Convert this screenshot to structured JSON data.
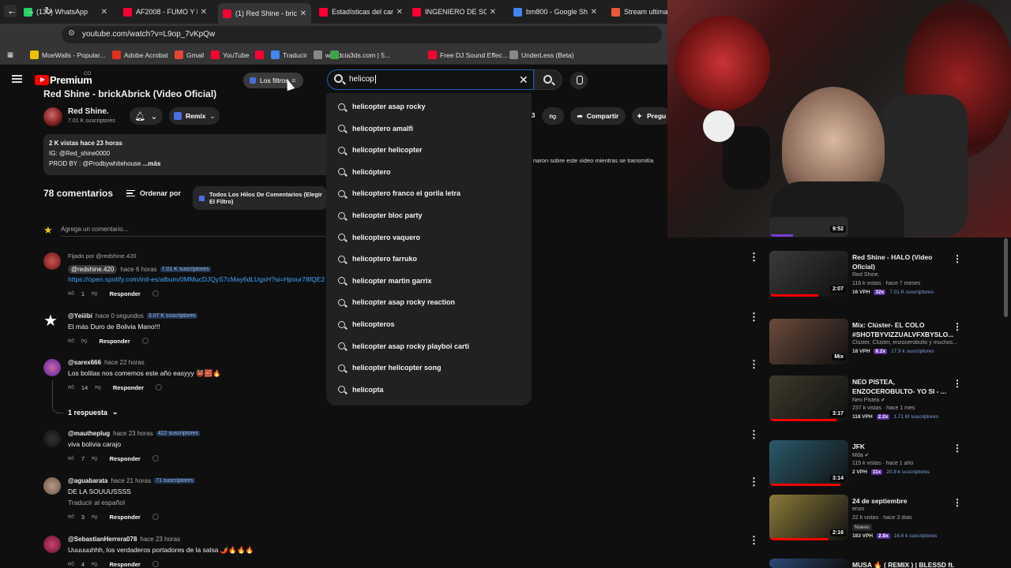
{
  "tabs": [
    {
      "label": "(130) WhatsApp",
      "color": "#25d366"
    },
    {
      "label": "AF2008 - FUMO Y DE",
      "color": "#ff0033"
    },
    {
      "label": "(1) Red Shine - brickA",
      "color": "#ff0033"
    },
    {
      "label": "Estadísticas del canal",
      "color": "#ff0033"
    },
    {
      "label": "INGENIERO DE SONI",
      "color": "#ff0033"
    },
    {
      "label": "bm800 - Google Sho",
      "color": "#4285f4"
    },
    {
      "label": "Stream ultimat",
      "color": "#e8583a"
    }
  ],
  "address": {
    "url": "youtube.com/watch?v=L9op_7vKpQw"
  },
  "bookmarks": [
    {
      "label": "MoeWalls - Popular...",
      "color": "#f2c200"
    },
    {
      "label": "Adobe Acrobat",
      "color": "#e0301e"
    },
    {
      "label": "Gmail",
      "color": "#ea4335"
    },
    {
      "label": "YouTube",
      "color": "#ff0033"
    },
    {
      "label": "",
      "color": "#ff0033"
    },
    {
      "label": "Traducir",
      "color": "#4285f4"
    },
    {
      "label": "worldcia3ds.com | 5...",
      "color": "#888888"
    },
    {
      "label": "",
      "color": "#3fa34d"
    },
    {
      "label": "Free DJ Sound Effec...",
      "color": "#ff0033"
    },
    {
      "label": "UnderLess (Beta)",
      "color": "#888888"
    }
  ],
  "youtube": {
    "brand": "Premium",
    "country": "CO",
    "filters_label": "Los filtros",
    "search_value": "helicop"
  },
  "suggestions": [
    "helicopter asap rocky",
    "helicoptero amalfi",
    "helicopter helicopter",
    "helicóptero",
    "helicoptero franco el gorila letra",
    "helicopter bloc party",
    "helicoptero vaquero",
    "helicoptero farruko",
    "helicopter martin garrix",
    "helicopter asap rocky reaction",
    "helicopteros",
    "helicopter asap rocky playboi carti",
    "helicopter helicopter song",
    "helicopta"
  ],
  "video": {
    "title": "Red Shine - brickAbrick (Video Oficial)",
    "channel": "Red Shine.",
    "subscribers": "7.01 K suscriptores",
    "remix_label": "Remix",
    "share_label": "Compartir",
    "ask_label": "Pregu",
    "like_count_partial": "3",
    "desc_line1": "2 K vistas  hace 23 horas",
    "desc_line2": "IG: @Red_shine0000",
    "desc_line3": "PROD BY : @Prodbywhitehouse",
    "desc_more": "...más",
    "desc_right": "naron sobre este video mientras se transmitía"
  },
  "comments_header": {
    "count": "78 comentarios",
    "sort_label": "Ordenar por",
    "filter_label": "Todos Los Hilos De Comentarios (Elegir El Filtro)",
    "add_placeholder": "Agrega un comentario..."
  },
  "comments": [
    {
      "pinned": "Fijado por @redshine.420",
      "handle": "@redshine.420",
      "ago": "hace 6 horas",
      "subs": "7.01 K suscriptores",
      "text": "https://open.spotify.com/intl-es/album/0MMucDJQyS7cMay6dLUgsH?si=Hpour78fQE2",
      "likes": "1",
      "reply": "Responder"
    },
    {
      "handle": "@Yeiiibi",
      "ago": "hace 0 segundos",
      "subs": "3.07 K suscriptores",
      "text": "El más Duro de Bolivia Mano!!!",
      "likes": "",
      "reply": "Responder"
    },
    {
      "handle": "@sarex666",
      "ago": "hace 22 horas",
      "subs": "",
      "text": "Los bolitas nos comemos este año easyyy 👹🧱🔥",
      "likes": "14",
      "reply": "Responder",
      "replies": "1 respuesta"
    },
    {
      "handle": "@mautheplug",
      "ago": "hace 23 horas",
      "subs": "422 suscriptores",
      "text": "viva bolivia carajo",
      "likes": "7",
      "reply": "Responder"
    },
    {
      "handle": "@aguabarata",
      "ago": "hace 21 horas",
      "subs": "71 suscriptores",
      "text": "DE LA SOUUUSSSS",
      "translate": "Traducir al español",
      "likes": "3",
      "reply": "Responder"
    },
    {
      "handle": "@SebastianHerrera078",
      "ago": "hace 23 horas",
      "subs": "",
      "text": "Uuuuuuhhh, los verdaderos portadores de la salsa 🌶️🔥🔥🔥",
      "likes": "4",
      "reply": "Responder"
    }
  ],
  "recommendations": [
    {
      "title": "",
      "meta": "",
      "duration": "9:52",
      "vph": "",
      "b1": "",
      "b2": ""
    },
    {
      "title": "Red Shine - HALO (Video Oficial)",
      "meta": "Red Shine.",
      "meta2": "116 k vistas · hace 7 meses",
      "duration": "2:07",
      "vph": "16 VPH",
      "b1": "32x",
      "b2": "7.01 K suscriptores",
      "thumb_color": "#3a3a3a",
      "progress": 0.62
    },
    {
      "title": "Mix: Clúster- EL COLO #SHOTBYVIZZUALVFXBYSLO...",
      "meta": "Clúster, Clúster, enzocerobulto y muchos...",
      "meta2": "",
      "duration": "Mix",
      "vph": "18 VPH",
      "b1": "8.2x",
      "b2": "17.9 k suscriptores",
      "thumb_color": "#6a4a3a",
      "progress": 0
    },
    {
      "title": "NEO PISTEA, ENZOCEROBULTO- YO SI - ...",
      "meta": "Neo Pistea ✔",
      "meta2": "237 k vistas · hace 1 mes",
      "duration": "3:17",
      "vph": "118 VPH",
      "b1": "2.2x",
      "b2": "1.71 M suscriptores",
      "thumb_color": "#3c3a2a",
      "progress": 0.85
    },
    {
      "title": "JFK",
      "meta": "Mda ✔",
      "meta2": "115 k vistas · hace 1 año",
      "duration": "3:14",
      "vph": "2 VPH",
      "b1": "11x",
      "b2": "20.8 k suscriptores",
      "thumb_color": "#2a5a6a",
      "progress": 0.9
    },
    {
      "title": "24 de septiembre",
      "meta": "enzo",
      "meta2": "22 k vistas · hace 3 días",
      "badge": "Nuevo",
      "duration": "2:16",
      "vph": "183 VPH",
      "b1": "2.8x",
      "b2": "16.6 k suscriptores",
      "thumb_color": "#8a7a3a",
      "progress": 0.75
    },
    {
      "title": "MUSA 🔥 ( REMIX ) | BLESSD ft.",
      "meta": "",
      "duration": "",
      "vph": "",
      "b1": "",
      "b2": "",
      "thumb_color": "#2a4a7a",
      "progress": 0
    }
  ]
}
